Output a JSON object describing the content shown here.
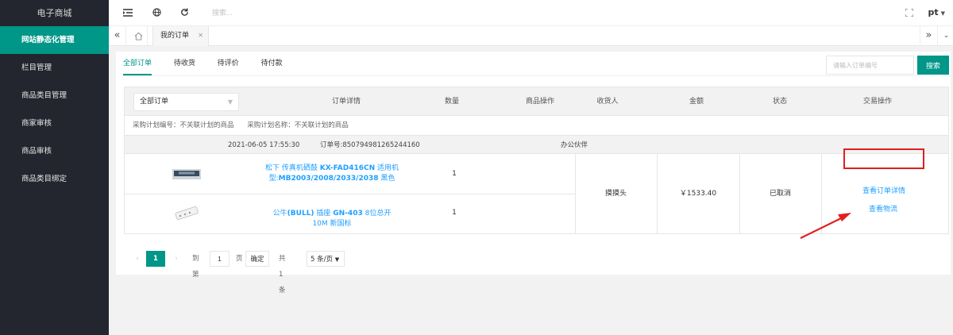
{
  "sidebar": {
    "brand": "电子商城",
    "items": [
      {
        "label": "网站静态化管理",
        "active": true
      },
      {
        "label": "栏目管理"
      },
      {
        "label": "商品类目管理"
      },
      {
        "label": "商家审核"
      },
      {
        "label": "商品审核"
      },
      {
        "label": "商品类目绑定"
      }
    ]
  },
  "header": {
    "search_placeholder": "搜索...",
    "user": "pt",
    "icons": [
      "menu-icon",
      "globe-icon",
      "refresh-icon",
      "fullscreen-icon"
    ]
  },
  "tabs": {
    "current": "我的订单",
    "icons": [
      "double-left-icon",
      "home-icon",
      "close-icon",
      "double-right-icon",
      "chevron-down-icon"
    ]
  },
  "order_tabs": [
    "全部订单",
    "待收货",
    "待评价",
    "待付款"
  ],
  "order_search": {
    "placeholder": "请输入订单编号",
    "button": "搜索"
  },
  "table": {
    "filter": "全部订单",
    "columns": [
      "订单详情",
      "数量",
      "商品操作",
      "收货人",
      "金额",
      "状态",
      "交易操作"
    ],
    "plan_no": "采购计划编号：不关联计划的商品",
    "plan_name": "采购计划名称：不关联计划的商品",
    "order": {
      "datetime": "2021-06-05 17:55:30",
      "order_no": "订单号:850794981265244160",
      "shop": "办公伙伴",
      "receiver": "摸摸头",
      "amount": "￥1533.40",
      "status": "已取消",
      "actions": {
        "details": "查看订单详情",
        "logistics": "查看物流"
      },
      "items": [
        {
          "name_pre": "松下 传真机硒鼓 ",
          "name_bold": "KX-FAD416CN",
          "name_mid": " 适用机型:",
          "name_bold2": "MB2003/2008/2033/2038",
          "name_post": " 黑色",
          "qty": "1"
        },
        {
          "name_pre": "公牛",
          "name_bold": "(BULL)",
          "name_mid": " 插座 ",
          "name_bold2": "GN-403",
          "name_post": " 8位总开 10M 新国标",
          "qty": "1"
        }
      ]
    }
  },
  "pagination": {
    "current": "1",
    "goto_label": "到第",
    "goto_value": "1",
    "page_unit": "页",
    "confirm": "确定",
    "total": "共 1 条",
    "page_size": "5 条/页"
  },
  "colors": {
    "accent": "#009688",
    "link": "#1e9fff",
    "sidebar": "#23262e",
    "annotation": "#e02020"
  }
}
